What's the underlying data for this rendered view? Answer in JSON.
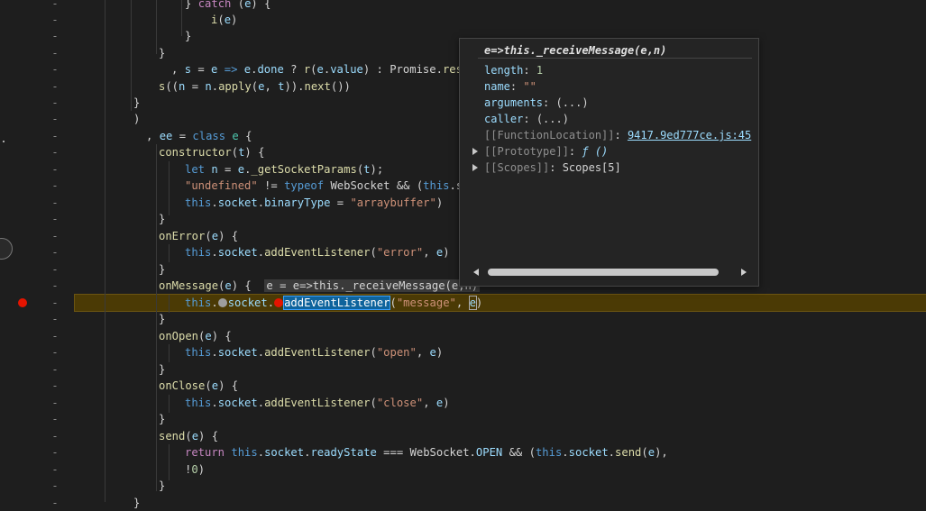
{
  "code_lines": [
    {
      "segs": [
        {
          "t": "} ",
          "c": "plain"
        },
        {
          "t": "catch",
          "c": "kw2"
        },
        {
          "t": " (",
          "c": "plain"
        },
        {
          "t": "e",
          "c": "var"
        },
        {
          "t": ") {",
          "c": "plain"
        }
      ]
    },
    {
      "segs": [
        {
          "t": "i",
          "c": "fn"
        },
        {
          "t": "(",
          "c": "plain"
        },
        {
          "t": "e",
          "c": "var"
        },
        {
          "t": ")",
          "c": "plain"
        }
      ]
    },
    {
      "segs": [
        {
          "t": "}",
          "c": "plain"
        }
      ]
    },
    {
      "segs": [
        {
          "t": "}",
          "c": "plain"
        }
      ]
    },
    {
      "segs": [
        {
          "t": ", ",
          "c": "plain"
        },
        {
          "t": "s",
          "c": "var"
        },
        {
          "t": " = ",
          "c": "plain"
        },
        {
          "t": "e",
          "c": "var"
        },
        {
          "t": " => ",
          "c": "kw"
        },
        {
          "t": "e",
          "c": "var"
        },
        {
          "t": ".",
          "c": "plain"
        },
        {
          "t": "done",
          "c": "var"
        },
        {
          "t": " ? ",
          "c": "plain"
        },
        {
          "t": "r",
          "c": "fn"
        },
        {
          "t": "(",
          "c": "plain"
        },
        {
          "t": "e",
          "c": "var"
        },
        {
          "t": ".",
          "c": "plain"
        },
        {
          "t": "value",
          "c": "var"
        },
        {
          "t": ") : Promise.",
          "c": "plain"
        },
        {
          "t": "res",
          "c": "fn"
        }
      ]
    },
    {
      "segs": [
        {
          "t": "s",
          "c": "fn"
        },
        {
          "t": "((",
          "c": "plain"
        },
        {
          "t": "n",
          "c": "var"
        },
        {
          "t": " = ",
          "c": "plain"
        },
        {
          "t": "n",
          "c": "var"
        },
        {
          "t": ".",
          "c": "plain"
        },
        {
          "t": "apply",
          "c": "fn"
        },
        {
          "t": "(",
          "c": "plain"
        },
        {
          "t": "e",
          "c": "var"
        },
        {
          "t": ", ",
          "c": "plain"
        },
        {
          "t": "t",
          "c": "var"
        },
        {
          "t": ")).",
          "c": "plain"
        },
        {
          "t": "next",
          "c": "fn"
        },
        {
          "t": "())",
          "c": "plain"
        }
      ]
    },
    {
      "segs": [
        {
          "t": "}",
          "c": "plain"
        }
      ]
    },
    {
      "segs": [
        {
          "t": ")",
          "c": "plain"
        }
      ]
    },
    {
      "segs": [
        {
          "t": ", ",
          "c": "plain"
        },
        {
          "t": "ee",
          "c": "var"
        },
        {
          "t": " = ",
          "c": "plain"
        },
        {
          "t": "class",
          "c": "kw"
        },
        {
          "t": " ",
          "c": "plain"
        },
        {
          "t": "e",
          "c": "cls"
        },
        {
          "t": " {",
          "c": "plain"
        }
      ]
    },
    {
      "segs": [
        {
          "t": "constructor",
          "c": "fn"
        },
        {
          "t": "(",
          "c": "plain"
        },
        {
          "t": "t",
          "c": "var"
        },
        {
          "t": ") {",
          "c": "plain"
        }
      ]
    },
    {
      "segs": [
        {
          "t": "let",
          "c": "kw"
        },
        {
          "t": " ",
          "c": "plain"
        },
        {
          "t": "n",
          "c": "var"
        },
        {
          "t": " = ",
          "c": "plain"
        },
        {
          "t": "e",
          "c": "var"
        },
        {
          "t": ".",
          "c": "plain"
        },
        {
          "t": "_getSocketParams",
          "c": "fn"
        },
        {
          "t": "(",
          "c": "plain"
        },
        {
          "t": "t",
          "c": "var"
        },
        {
          "t": ");",
          "c": "plain"
        }
      ]
    },
    {
      "segs": [
        {
          "t": "\"undefined\"",
          "c": "str"
        },
        {
          "t": " != ",
          "c": "plain"
        },
        {
          "t": "typeof",
          "c": "kw"
        },
        {
          "t": " WebSocket && (",
          "c": "plain"
        },
        {
          "t": "this",
          "c": "kw"
        },
        {
          "t": ".s",
          "c": "plain"
        }
      ]
    },
    {
      "segs": [
        {
          "t": "this",
          "c": "kw"
        },
        {
          "t": ".",
          "c": "plain"
        },
        {
          "t": "socket",
          "c": "var"
        },
        {
          "t": ".",
          "c": "plain"
        },
        {
          "t": "binaryType",
          "c": "var"
        },
        {
          "t": " = ",
          "c": "plain"
        },
        {
          "t": "\"arraybuffer\"",
          "c": "str"
        },
        {
          "t": ")",
          "c": "plain"
        }
      ]
    },
    {
      "segs": [
        {
          "t": "}",
          "c": "plain"
        }
      ]
    },
    {
      "segs": [
        {
          "t": "onError",
          "c": "fn"
        },
        {
          "t": "(",
          "c": "plain"
        },
        {
          "t": "e",
          "c": "var"
        },
        {
          "t": ") {",
          "c": "plain"
        }
      ]
    },
    {
      "segs": [
        {
          "t": "this",
          "c": "kw"
        },
        {
          "t": ".",
          "c": "plain"
        },
        {
          "t": "socket",
          "c": "var"
        },
        {
          "t": ".",
          "c": "plain"
        },
        {
          "t": "addEventListener",
          "c": "fn"
        },
        {
          "t": "(",
          "c": "plain"
        },
        {
          "t": "\"error\"",
          "c": "str"
        },
        {
          "t": ", ",
          "c": "plain"
        },
        {
          "t": "e",
          "c": "var"
        },
        {
          "t": ")",
          "c": "plain"
        }
      ]
    },
    {
      "segs": [
        {
          "t": "}",
          "c": "plain"
        }
      ]
    },
    {
      "segs": [
        {
          "t": "onMessage",
          "c": "fn"
        },
        {
          "t": "(",
          "c": "plain"
        },
        {
          "t": "e",
          "c": "var"
        },
        {
          "t": ") {  ",
          "c": "plain"
        },
        {
          "t": "e = e=>this._receiveMessage(e,n)",
          "c": "inline"
        }
      ]
    },
    {
      "segs": [
        {
          "t": "this",
          "c": "kw"
        },
        {
          "t": ".",
          "c": "plain"
        },
        {
          "t": "",
          "c": "bpgray"
        },
        {
          "t": "socket",
          "c": "var"
        },
        {
          "t": ".",
          "c": "plain"
        },
        {
          "t": "",
          "c": "bpred"
        },
        {
          "t": "addEventListener",
          "c": "sel"
        },
        {
          "t": "(",
          "c": "plain"
        },
        {
          "t": "\"message\"",
          "c": "str"
        },
        {
          "t": ", ",
          "c": "plain"
        },
        {
          "t": "e",
          "c": "cursor"
        },
        {
          "t": ")",
          "c": "plain"
        }
      ]
    },
    {
      "segs": [
        {
          "t": "}",
          "c": "plain"
        }
      ]
    },
    {
      "segs": [
        {
          "t": "onOpen",
          "c": "fn"
        },
        {
          "t": "(",
          "c": "plain"
        },
        {
          "t": "e",
          "c": "var"
        },
        {
          "t": ") {",
          "c": "plain"
        }
      ]
    },
    {
      "segs": [
        {
          "t": "this",
          "c": "kw"
        },
        {
          "t": ".",
          "c": "plain"
        },
        {
          "t": "socket",
          "c": "var"
        },
        {
          "t": ".",
          "c": "plain"
        },
        {
          "t": "addEventListener",
          "c": "fn"
        },
        {
          "t": "(",
          "c": "plain"
        },
        {
          "t": "\"open\"",
          "c": "str"
        },
        {
          "t": ", ",
          "c": "plain"
        },
        {
          "t": "e",
          "c": "var"
        },
        {
          "t": ")",
          "c": "plain"
        }
      ]
    },
    {
      "segs": [
        {
          "t": "}",
          "c": "plain"
        }
      ]
    },
    {
      "segs": [
        {
          "t": "onClose",
          "c": "fn"
        },
        {
          "t": "(",
          "c": "plain"
        },
        {
          "t": "e",
          "c": "var"
        },
        {
          "t": ") {",
          "c": "plain"
        }
      ]
    },
    {
      "segs": [
        {
          "t": "this",
          "c": "kw"
        },
        {
          "t": ".",
          "c": "plain"
        },
        {
          "t": "socket",
          "c": "var"
        },
        {
          "t": ".",
          "c": "plain"
        },
        {
          "t": "addEventListener",
          "c": "fn"
        },
        {
          "t": "(",
          "c": "plain"
        },
        {
          "t": "\"close\"",
          "c": "str"
        },
        {
          "t": ", ",
          "c": "plain"
        },
        {
          "t": "e",
          "c": "var"
        },
        {
          "t": ")",
          "c": "plain"
        }
      ]
    },
    {
      "segs": [
        {
          "t": "}",
          "c": "plain"
        }
      ]
    },
    {
      "segs": [
        {
          "t": "send",
          "c": "fn"
        },
        {
          "t": "(",
          "c": "plain"
        },
        {
          "t": "e",
          "c": "var"
        },
        {
          "t": ") {",
          "c": "plain"
        }
      ]
    },
    {
      "segs": [
        {
          "t": "return",
          "c": "kw2"
        },
        {
          "t": " ",
          "c": "plain"
        },
        {
          "t": "this",
          "c": "kw"
        },
        {
          "t": ".",
          "c": "plain"
        },
        {
          "t": "socket",
          "c": "var"
        },
        {
          "t": ".",
          "c": "plain"
        },
        {
          "t": "readyState",
          "c": "var"
        },
        {
          "t": " === WebSocket.",
          "c": "plain"
        },
        {
          "t": "OPEN",
          "c": "var"
        },
        {
          "t": " && (",
          "c": "plain"
        },
        {
          "t": "this",
          "c": "kw"
        },
        {
          "t": ".",
          "c": "plain"
        },
        {
          "t": "socket",
          "c": "var"
        },
        {
          "t": ".",
          "c": "plain"
        },
        {
          "t": "send",
          "c": "fn"
        },
        {
          "t": "(",
          "c": "plain"
        },
        {
          "t": "e",
          "c": "var"
        },
        {
          "t": "),",
          "c": "plain"
        }
      ]
    },
    {
      "segs": [
        {
          "t": "!",
          "c": "plain"
        },
        {
          "t": "0",
          "c": "num"
        },
        {
          "t": ")",
          "c": "plain"
        }
      ]
    },
    {
      "segs": [
        {
          "t": "}",
          "c": "plain"
        }
      ]
    },
    {
      "segs": [
        {
          "t": "}",
          "c": "plain"
        }
      ]
    }
  ],
  "gutter_marker": "-",
  "popup": {
    "title": "e=>this._receiveMessage(e,n)",
    "props": [
      {
        "key": "length",
        "sep": ": ",
        "val": "1",
        "kc": "pkey",
        "vc": "pval-num"
      },
      {
        "key": "name",
        "sep": ": ",
        "val": "\"\"",
        "kc": "pkey",
        "vc": "pval-str"
      },
      {
        "key": "arguments",
        "sep": ": ",
        "val": "(...)",
        "kc": "pkey",
        "vc": "plain"
      },
      {
        "key": "caller",
        "sep": ": ",
        "val": "(...)",
        "kc": "pkey",
        "vc": "plain"
      },
      {
        "key": "[[FunctionLocation]]",
        "sep": ": ",
        "val": "9417.9ed777ce.js:45",
        "kc": "pkey-dim",
        "vc": "pval-link"
      },
      {
        "key": "[[Prototype]]",
        "sep": ": ",
        "val": "ƒ ()",
        "kc": "pkey-dim",
        "vc": "pval-fn"
      },
      {
        "key": "[[Scopes]]",
        "sep": ": ",
        "val": "Scopes[5]",
        "kc": "pkey-dim",
        "vc": "plain"
      }
    ]
  }
}
